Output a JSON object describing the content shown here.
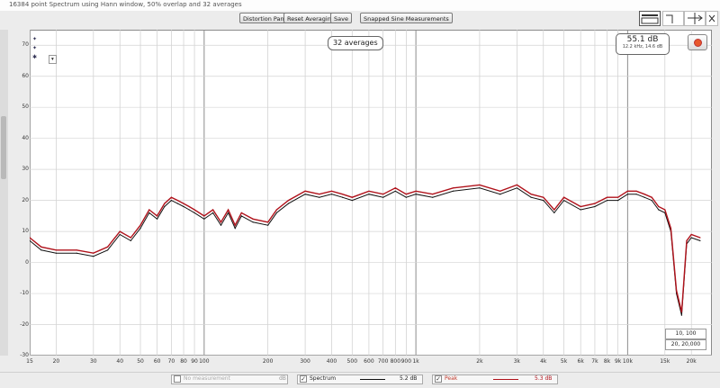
{
  "window": {
    "title": "16384 point Spectrum using Hann window, 50% overlap and 32 averages"
  },
  "toolbar": {
    "buttons": [
      {
        "label": "Distortion Panel"
      },
      {
        "label": "Reset Averaging"
      },
      {
        "label": "Save"
      },
      {
        "label": "Snapped Sine Measurements"
      }
    ]
  },
  "overlay": {
    "averages_label": "32 averages",
    "spl_value": "55.1 dB",
    "spl_sub": "12.2 kHz, 14.6 dB"
  },
  "axis": {
    "y_ticks": [
      "70",
      "60",
      "50",
      "40",
      "30",
      "20",
      "10",
      "0",
      "-10",
      "-20",
      "-30"
    ],
    "x_ticks": [
      "15",
      "20",
      "30",
      "40",
      "50",
      "60",
      "70",
      "80",
      "90",
      "100",
      "200",
      "300",
      "400",
      "500",
      "600",
      "700",
      "800",
      "900",
      "1k",
      "2k",
      "3k",
      "4k",
      "5k",
      "6k",
      "7k",
      "8k",
      "9k",
      "10k",
      "15k",
      "20k"
    ],
    "y_unit": "dB"
  },
  "range_boxes": {
    "low": "10, 100",
    "high": "20, 20,000"
  },
  "legend": {
    "items": [
      {
        "name": "No measurement",
        "value": "dB",
        "checked": false,
        "color": "#999999"
      },
      {
        "name": "Spectrum",
        "value": "5.2 dB",
        "checked": true,
        "color": "#111111"
      },
      {
        "name": "Peak",
        "value": "5.3 dB",
        "checked": true,
        "color": "#b0121b"
      }
    ]
  },
  "chart_data": {
    "type": "line",
    "xscale": "log",
    "xlim": [
      15,
      25000
    ],
    "ylim": [
      -30,
      75
    ],
    "grid": true,
    "legend_position": "bottom",
    "series": [
      {
        "name": "Spectrum",
        "color": "#111111",
        "x": [
          15,
          17,
          20,
          25,
          30,
          35,
          40,
          45,
          50,
          55,
          60,
          65,
          70,
          75,
          80,
          85,
          90,
          100,
          110,
          120,
          130,
          140,
          150,
          170,
          200,
          220,
          250,
          300,
          350,
          400,
          450,
          500,
          600,
          700,
          800,
          900,
          1000,
          1200,
          1500,
          2000,
          2500,
          3000,
          3500,
          4000,
          4500,
          5000,
          6000,
          7000,
          8000,
          9000,
          10000,
          11000,
          12000,
          13000,
          14000,
          15000,
          16000,
          17000,
          18000,
          19000,
          20000,
          22000
        ],
        "y": [
          7,
          4,
          3,
          3,
          2,
          4,
          9,
          7,
          11,
          16,
          14,
          18,
          20,
          19,
          18,
          17,
          16,
          14,
          16,
          12,
          16,
          11,
          15,
          13,
          12,
          16,
          19,
          22,
          21,
          22,
          21,
          20,
          22,
          21,
          23,
          21,
          22,
          21,
          23,
          24,
          22,
          24,
          21,
          20,
          16,
          20,
          17,
          18,
          20,
          20,
          22,
          22,
          21,
          20,
          17,
          16,
          10,
          -10,
          -17,
          6,
          8,
          7
        ]
      },
      {
        "name": "Peak",
        "color": "#b0121b",
        "x": [
          15,
          17,
          20,
          25,
          30,
          35,
          40,
          45,
          50,
          55,
          60,
          65,
          70,
          75,
          80,
          85,
          90,
          100,
          110,
          120,
          130,
          140,
          150,
          170,
          200,
          220,
          250,
          300,
          350,
          400,
          450,
          500,
          600,
          700,
          800,
          900,
          1000,
          1200,
          1500,
          2000,
          2500,
          3000,
          3500,
          4000,
          4500,
          5000,
          6000,
          7000,
          8000,
          9000,
          10000,
          11000,
          12000,
          13000,
          14000,
          15000,
          16000,
          17000,
          18000,
          19000,
          20000,
          22000
        ],
        "y": [
          8,
          5,
          4,
          4,
          3,
          5,
          10,
          8,
          12,
          17,
          15,
          19,
          21,
          20,
          19,
          18,
          17,
          15,
          17,
          13,
          17,
          12,
          16,
          14,
          13,
          17,
          20,
          23,
          22,
          23,
          22,
          21,
          23,
          22,
          24,
          22,
          23,
          22,
          24,
          25,
          23,
          25,
          22,
          21,
          17,
          21,
          18,
          19,
          21,
          21,
          23,
          23,
          22,
          21,
          18,
          17,
          11,
          -9,
          -16,
          7,
          9,
          8
        ]
      }
    ]
  }
}
